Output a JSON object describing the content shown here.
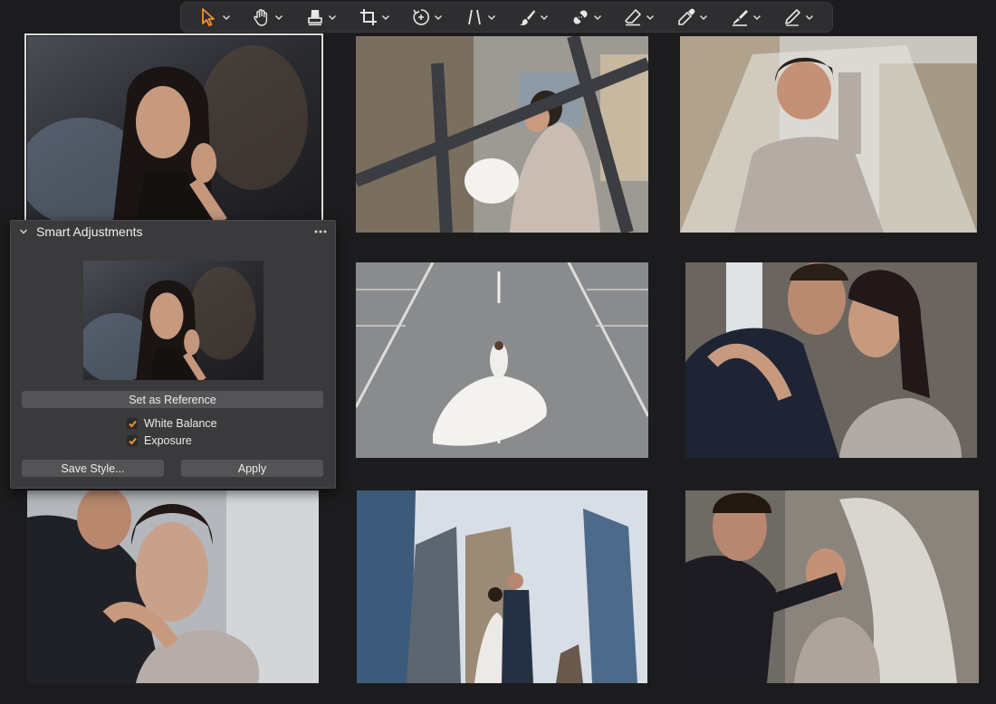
{
  "toolbar": {
    "tools": [
      {
        "icon": "select-arrow-icon",
        "active": true
      },
      {
        "icon": "pan-hand-icon"
      },
      {
        "icon": "stamp-icon"
      },
      {
        "icon": "crop-icon"
      },
      {
        "icon": "rotate-icon"
      },
      {
        "icon": "keystone-icon"
      },
      {
        "icon": "brush-icon"
      },
      {
        "icon": "heal-bandage-icon"
      },
      {
        "icon": "eraser-icon"
      },
      {
        "icon": "color-picker-icon"
      },
      {
        "icon": "gradient-icon"
      },
      {
        "icon": "annotate-pen-icon"
      }
    ],
    "accent_color": "#f2922b"
  },
  "smart_adjustments": {
    "title": "Smart Adjustments",
    "set_reference_label": "Set as Reference",
    "options": [
      {
        "label": "White Balance",
        "checked": true
      },
      {
        "label": "Exposure",
        "checked": true
      }
    ],
    "save_style_label": "Save Style...",
    "apply_label": "Apply"
  },
  "photos": [
    {
      "subject": "woman applying lipstick",
      "selected": true
    },
    {
      "subject": "bride with flowers through railing"
    },
    {
      "subject": "laughing bride under veil"
    },
    {
      "subject": "bride lying on parking deck"
    },
    {
      "subject": "couple embracing"
    },
    {
      "subject": "couple close-up"
    },
    {
      "subject": "couple among skyscrapers"
    },
    {
      "subject": "couple with veil on rooftop"
    }
  ]
}
